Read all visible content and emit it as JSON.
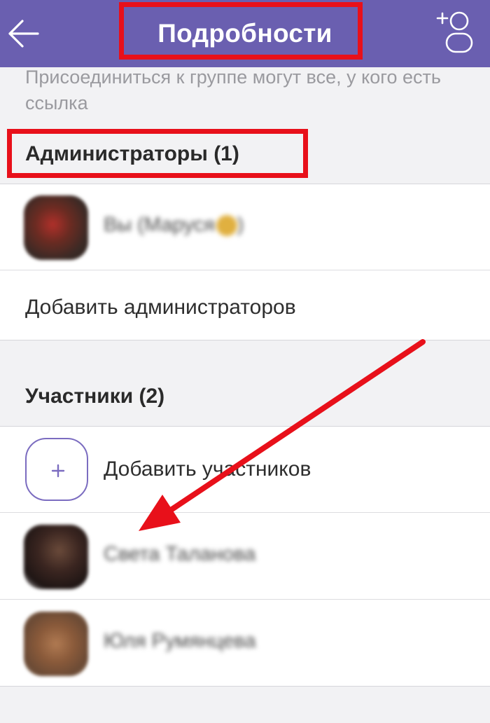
{
  "header": {
    "title": "Подробности"
  },
  "hint_text": "Присоединиться к группе могут все, у кого есть ссылка",
  "admins": {
    "section_title": "Администраторы (1)",
    "members": [
      {
        "name": "Вы (Маруся",
        "avatar": "avatar-blurred"
      }
    ],
    "add_label": "Добавить администраторов"
  },
  "participants": {
    "section_title": "Участники (2)",
    "add_label": "Добавить участников",
    "members": [
      {
        "name": "Света Таланова",
        "avatar": "avatar-blurred"
      },
      {
        "name": "Юля Румянцева",
        "avatar": "avatar-blurred"
      }
    ]
  },
  "icons": {
    "back": "arrow-left-icon",
    "add_user": "add-user-icon",
    "add_participant": "plus-icon"
  },
  "colors": {
    "header_bg": "#6a5fb0",
    "accent": "#7b6cc0",
    "annotation": "#e8101a",
    "page_bg": "#f2f2f4"
  }
}
